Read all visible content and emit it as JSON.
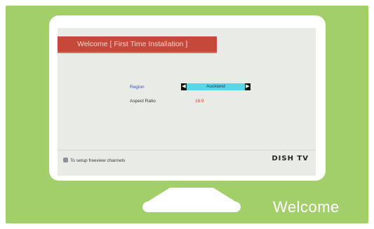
{
  "screen": {
    "title": "Welcome [ First Time Installation ]",
    "fields": [
      {
        "label": "Region",
        "value": "Auckland"
      },
      {
        "label": "Aspect Ratio",
        "value": "16:9"
      }
    ],
    "arrows": {
      "left": "◀",
      "right": "▶"
    },
    "footer_hint": "To setup freeview channels",
    "brand": "DISH TV"
  },
  "caption": "Welcome",
  "colors": {
    "frame_background": "#a3cf6a",
    "title_bar": "#c6483a",
    "selector": "#58d7e8",
    "aspect_value": "#e33a3a",
    "region_label": "#3b4ec2"
  }
}
